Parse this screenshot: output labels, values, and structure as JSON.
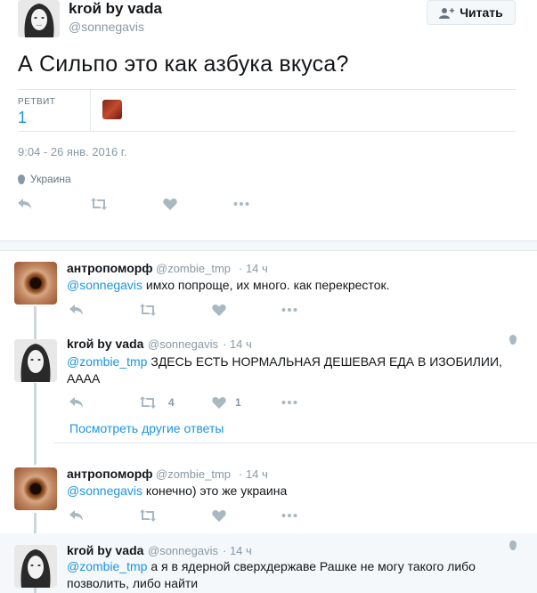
{
  "tweet": {
    "author_name": "kroй by vada",
    "author_handle": "@sonnegavis",
    "follow_label": "Читать",
    "text": "А Сильпо это как азбука вкуса?",
    "retweet_label": "РЕТВИТ",
    "retweet_count": "1",
    "timestamp": "9:04 - 26 янв. 2016 г.",
    "location": "Украина"
  },
  "replies": [
    {
      "author_name": "антропоморф",
      "author_handle": "@zombie_tmp",
      "time": "· 14 ч",
      "mention": "@sonnegavis",
      "text": " имхо попроще, их много. как перекресток."
    },
    {
      "author_name": "kroй by vada",
      "author_handle": "@sonnegavis",
      "time": "· 14 ч",
      "mention": "@zombie_tmp",
      "text": " ЗДЕСЬ ЕСТЬ НОРМАЛЬНАЯ ДЕШЕВАЯ ЕДА В ИЗОБИЛИИ, АААА",
      "retweets": "4",
      "likes": "1"
    },
    {
      "author_name": "антропоморф",
      "author_handle": "@zombie_tmp",
      "time": "· 14 ч",
      "mention": "@sonnegavis",
      "text": " конечно) это же украина"
    },
    {
      "author_name": "kroй by vada",
      "author_handle": "@sonnegavis",
      "time": "· 14 ч",
      "mention": "@zombie_tmp",
      "text": " а я в ядерной сверхдержаве Рашке не могу такого либо позволить, либо найти"
    }
  ],
  "more_replies_label": "Посмотреть другие ответы",
  "colors": {
    "link": "#1b95e0",
    "muted": "#8899a6",
    "icon": "#aab8c2"
  }
}
